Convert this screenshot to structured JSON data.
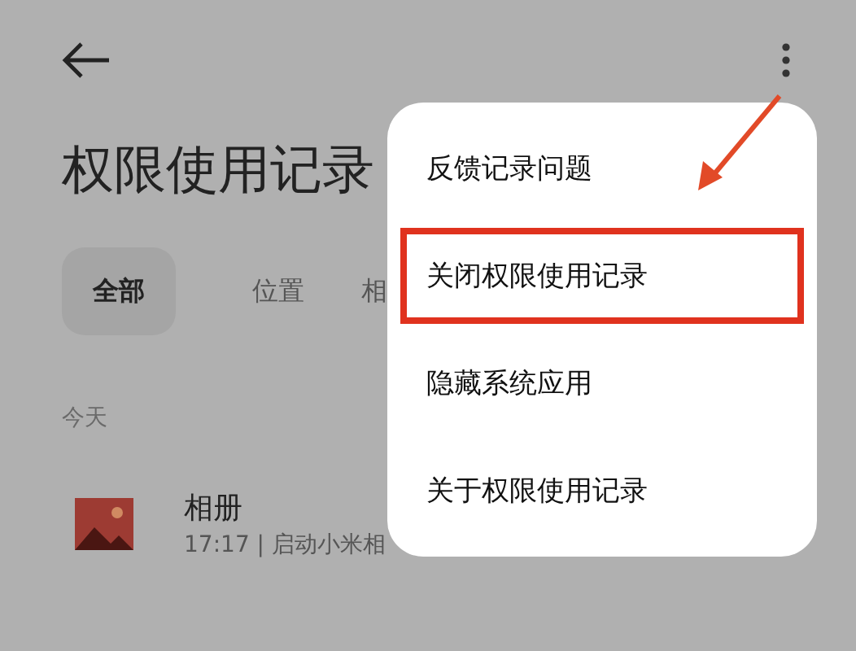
{
  "header": {
    "title": "权限使用记录"
  },
  "tabs": [
    {
      "label": "全部",
      "selected": true
    },
    {
      "label": "位置",
      "selected": false
    },
    {
      "label": "相",
      "selected": false
    }
  ],
  "section": "今天",
  "records": [
    {
      "app": "相册",
      "detail": "17:17 | 启动小米相"
    }
  ],
  "menu": {
    "items": [
      {
        "label": "反馈记录问题",
        "highlighted": false
      },
      {
        "label": "关闭权限使用记录",
        "highlighted": true
      },
      {
        "label": "隐藏系统应用",
        "highlighted": false
      },
      {
        "label": "关于权限使用记录",
        "highlighted": false
      }
    ]
  }
}
